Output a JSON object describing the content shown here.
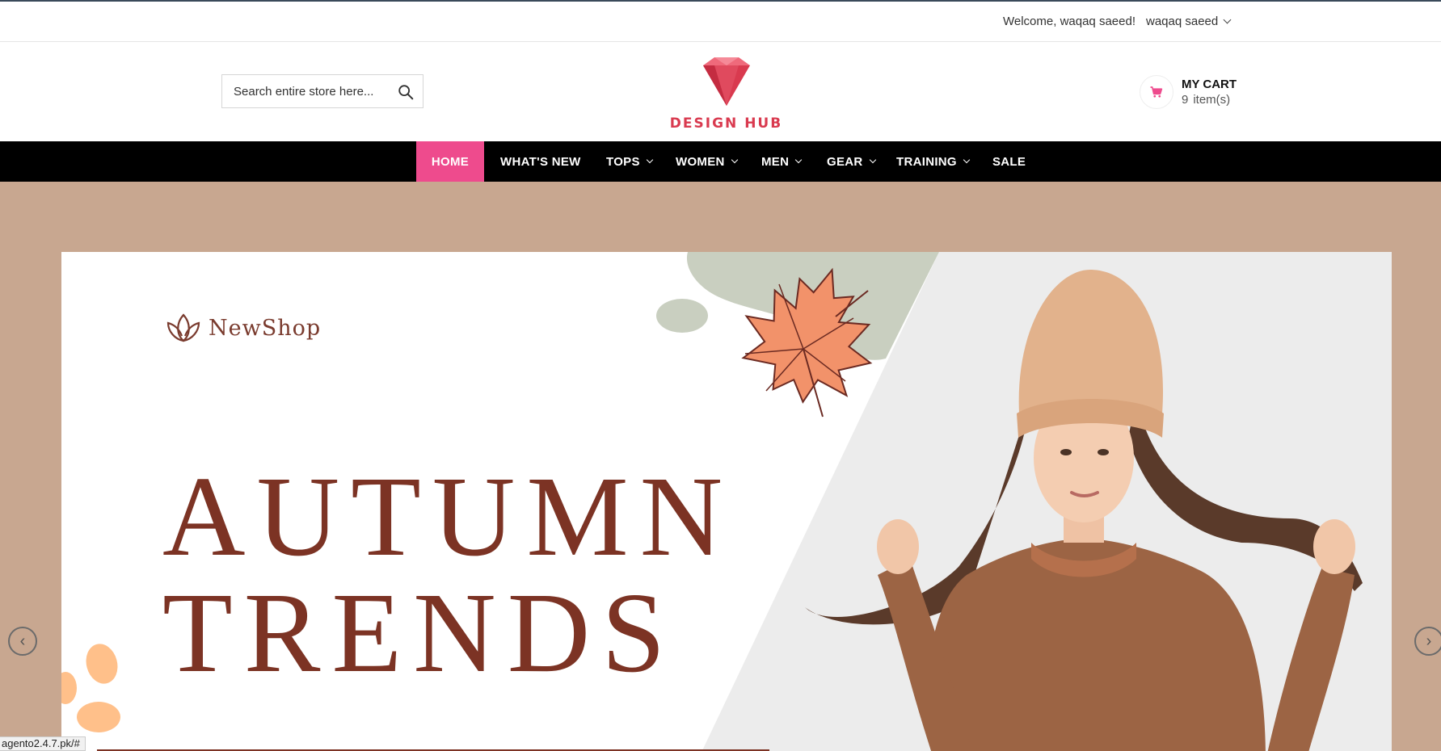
{
  "topbar": {
    "welcome": "Welcome, waqaq saeed!",
    "user_name": "waqaq saeed"
  },
  "header": {
    "search_placeholder": "Search entire store here...",
    "logo_text": "DESIGN HUB",
    "cart_title": "MY CART",
    "cart_count": "9",
    "cart_items_label": "item(s)"
  },
  "nav": {
    "items": [
      {
        "label": "HOME",
        "active": true
      },
      {
        "label": "WHAT'S NEW"
      },
      {
        "label": "TOPS"
      },
      {
        "label": "WOMEN"
      },
      {
        "label": "MEN"
      },
      {
        "label": "GEAR"
      },
      {
        "label": "TRAINING"
      },
      {
        "label": "SALE"
      }
    ]
  },
  "banner": {
    "brand": "NewShop",
    "headline_line1": "AUTUMN",
    "headline_line2": "TRENDS",
    "prev_arrow": "‹",
    "next_arrow": "›"
  },
  "status": {
    "url": "agento2.4.7.pk/#"
  },
  "colors": {
    "nav_background": "#000000",
    "nav_active": "#ee4b8d",
    "hero_background": "#c8a790",
    "headline": "#7c3324",
    "logo": "#d93a4f"
  },
  "icons": {
    "search": "search-icon",
    "cart": "cart-icon",
    "logo": "diamond-icon",
    "brand": "lotus-icon",
    "leaf": "maple-leaf-illustration"
  }
}
